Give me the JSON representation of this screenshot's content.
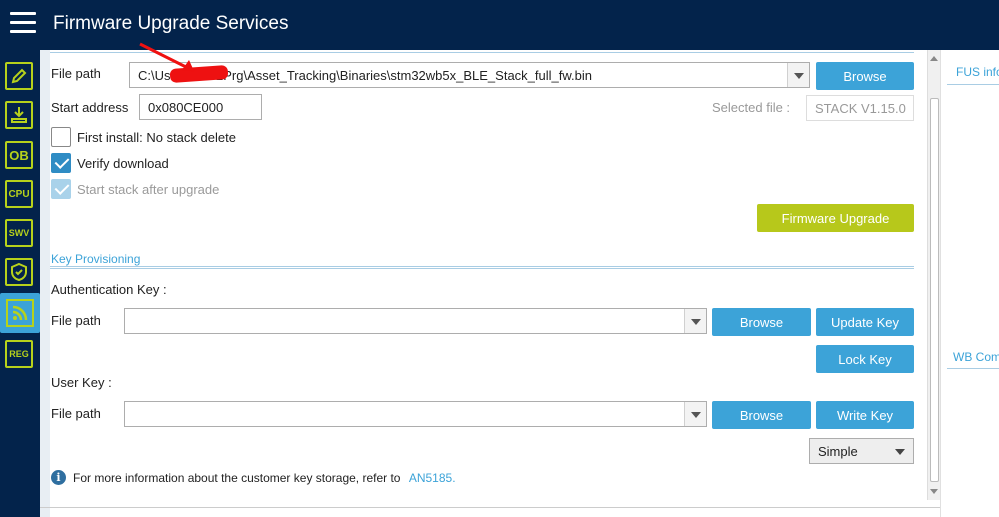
{
  "header": {
    "title": "Firmware Upgrade Services"
  },
  "sidebar": {
    "items": [
      {
        "name": "edit",
        "label": ""
      },
      {
        "name": "download",
        "label": ""
      },
      {
        "name": "ob",
        "label": "OB"
      },
      {
        "name": "cpu",
        "label": "CPU"
      },
      {
        "name": "swv",
        "label": "SWV"
      },
      {
        "name": "security",
        "label": ""
      },
      {
        "name": "wireless",
        "label": ""
      },
      {
        "name": "reg",
        "label": "REG"
      }
    ]
  },
  "firmware": {
    "file_path_label": "File path",
    "file_path_value": "C:\\Use           STM32Prg\\Asset_Tracking\\Binaries\\stm32wb5x_BLE_Stack_full_fw.bin",
    "browse_label": "Browse",
    "start_address_label": "Start address",
    "start_address_value": "0x080CE000",
    "selected_file_label": "Selected file :",
    "selected_file_value": "STACK V1.15.0",
    "first_install_label": "First install: No stack delete",
    "verify_download_label": "Verify download",
    "start_stack_label": "Start stack after upgrade",
    "upgrade_button": "Firmware Upgrade"
  },
  "key_provisioning": {
    "section_title": "Key Provisioning",
    "auth_key_label": "Authentication Key :",
    "auth_file_path_label": "File path",
    "auth_browse": "Browse",
    "update_key": "Update Key",
    "lock_key": "Lock Key",
    "user_key_label": "User Key :",
    "user_file_path_label": "File path",
    "user_browse": "Browse",
    "write_key": "Write Key",
    "mode_select": "Simple",
    "info_text": "For more information about the customer key storage, refer to",
    "info_link": "AN5185."
  },
  "right_panel": {
    "fus_title": "FUS info",
    "wb_title": "WB Com"
  },
  "colors": {
    "header_bg": "#03234b",
    "accent_blue": "#3ca3d8",
    "accent_green": "#b7c81b"
  }
}
